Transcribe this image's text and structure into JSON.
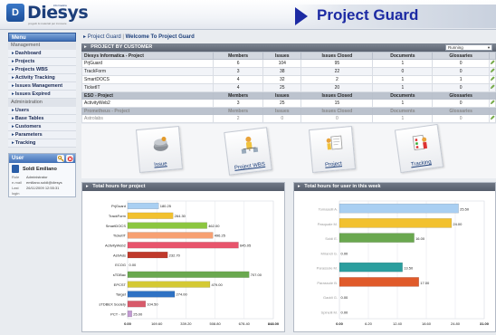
{
  "header": {
    "logo_mark": "D",
    "logo_text": "Diesys",
    "logo_sup": "informatica",
    "logo_tagline": "progetti & materiali per innovare",
    "app_title": "Project Guard"
  },
  "breadcrumb": {
    "root": "Project Guard",
    "separator": "|",
    "welcome": "Welcome To Project Guard"
  },
  "sidebar": {
    "menu_title": "Menu",
    "sections": [
      {
        "title": "Management",
        "items": [
          "Dashboard",
          "Projects",
          "Projects WBS",
          "Activity Tracking",
          "Issues Management",
          "Issues Expired"
        ]
      },
      {
        "title": "Administration",
        "items": [
          "Users",
          "Base Tables",
          "Customers",
          "Parameters",
          "Tracking"
        ]
      }
    ]
  },
  "user": {
    "title": "User",
    "name": "Soldi Emiliano",
    "rows": [
      {
        "k": "Role",
        "v": "Administrator"
      },
      {
        "k": "e-mail",
        "v": "emiliano.soldi@diesys"
      },
      {
        "k": "Last login",
        "v": "26/11/2009 12:55:31"
      }
    ]
  },
  "projects": {
    "bar_title": "PROJECT BY CUSTOMER",
    "filter_selected": "Running",
    "columns": [
      "Issues",
      "Issues Closed",
      "Documents",
      "Glossaries"
    ],
    "members_label": "Members",
    "groups": [
      {
        "customer": "Diesys Informatica - Project",
        "rows": [
          [
            "PrjGuard",
            "6",
            "104",
            "95",
            "1",
            "0"
          ],
          [
            "TrackForm",
            "3",
            "38",
            "22",
            "0",
            "0"
          ],
          [
            "SmartDOCS",
            "4",
            "32",
            "2",
            "1",
            "1"
          ],
          [
            "TicketIT",
            "4",
            "25",
            "20",
            "1",
            "0"
          ]
        ]
      },
      {
        "customer": "ESO - Project",
        "rows": [
          [
            "ActivityWeb2",
            "3",
            "25",
            "15",
            "1",
            "0"
          ]
        ]
      },
      {
        "customer": "Prometheus - Project",
        "rows": [
          [
            "Astrolabs",
            "2",
            "0",
            "0",
            "1",
            "0"
          ]
        ]
      }
    ]
  },
  "tiles": [
    "Issue",
    "Project WBS",
    "Project",
    "Tracking"
  ],
  "chart_data": [
    {
      "type": "bar",
      "orientation": "horizontal",
      "title": "Total hours for project",
      "categories": [
        "PrjGuard",
        "TrackForm",
        "SmartDOCS",
        "TicketIT",
        "ActivityWeb2",
        "AstrAds",
        "ECOG",
        "sTDBac",
        "EPCST",
        "Target",
        "sTDBEX Society",
        "PCT - XP"
      ],
      "values": [
        180.25,
        264.3,
        462.0,
        496.25,
        645.05,
        232.7,
        0.0,
        707.0,
        479.0,
        274.0,
        104.5,
        25.0
      ],
      "value_labels": [
        "180.25",
        "264.30",
        "462.00",
        "496.25",
        "645.05",
        "232.70",
        "0.00",
        "707.00",
        "479.00",
        "274.00",
        "104.50",
        "25.00"
      ],
      "colors": [
        "#a9cff2",
        "#f2c12e",
        "#8cc63f",
        "#f7a072",
        "#e8546c",
        "#c0392b",
        "#999999",
        "#6aa84f",
        "#d4c933",
        "#2f72c4",
        "#d85a6a",
        "#c39bd3"
      ],
      "x_ticks": [
        "0.00",
        "169.60",
        "339.20",
        "508.80",
        "678.40",
        "848.00"
      ],
      "xlim": [
        0,
        848
      ]
    },
    {
      "type": "bar",
      "orientation": "horizontal",
      "title": "Total hours for user in this week",
      "categories": [
        "Tomaselli A.",
        "Pasquale M.",
        "Soldi E.",
        "Mirandi G.",
        "Parassole M.",
        "Parassole B.",
        "Gaddi G.",
        "Spinelli M."
      ],
      "values": [
        25.5,
        24.0,
        16.0,
        0.0,
        13.5,
        17.0,
        0.0,
        0.0
      ],
      "value_labels": [
        "25.50",
        "24.00",
        "16.00",
        "0.00",
        "13.50",
        "17.00",
        "0.00",
        "0.00"
      ],
      "colors": [
        "#a9cff2",
        "#f2c12e",
        "#6aa84f",
        "#999999",
        "#2b9e9e",
        "#e05a2a",
        "#999999",
        "#999999"
      ],
      "x_ticks": [
        "0.00",
        "6.20",
        "12.40",
        "18.60",
        "24.80",
        "31.00"
      ],
      "xlim": [
        0,
        31
      ]
    }
  ]
}
